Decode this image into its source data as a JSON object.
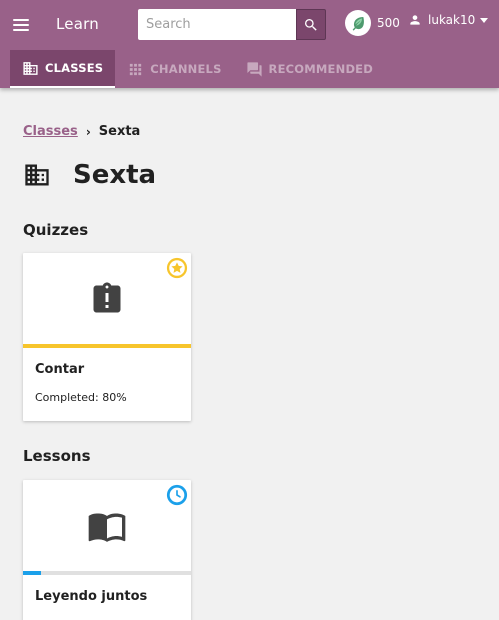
{
  "app_bar": {
    "title": "Learn",
    "search": {
      "placeholder": "Search"
    },
    "points": "500",
    "username": "lukak10"
  },
  "tabs": [
    {
      "label": "CLASSES",
      "icon": "classroom-icon",
      "active": true
    },
    {
      "label": "CHANNELS",
      "icon": "grid-icon",
      "active": false
    },
    {
      "label": "RECOMMENDED",
      "icon": "forum-icon",
      "active": false
    }
  ],
  "breadcrumb": {
    "parent": "Classes",
    "separator": "›",
    "current": "Sexta"
  },
  "page": {
    "title": "Sexta",
    "icon": "classroom-icon"
  },
  "sections": {
    "quizzes": {
      "heading": "Quizzes",
      "cards": [
        {
          "title": "Contar",
          "subtitle": "Completed: 80%",
          "icon": "assignment-late-icon",
          "badge_icon": "star-icon",
          "progress": 1.0,
          "progress_color": "#f7c52c"
        }
      ]
    },
    "lessons": {
      "heading": "Lessons",
      "cards": [
        {
          "title": "Leyendo juntos",
          "icon": "book-icon",
          "badge_icon": "clock-icon",
          "progress": 0.11,
          "progress_color": "#1ba0ea"
        }
      ]
    }
  },
  "colors": {
    "brand": "#996189",
    "brand_dark": "#7b466c",
    "quiz_progress": "#f7c52c",
    "lesson_progress": "#1ba0ea"
  }
}
